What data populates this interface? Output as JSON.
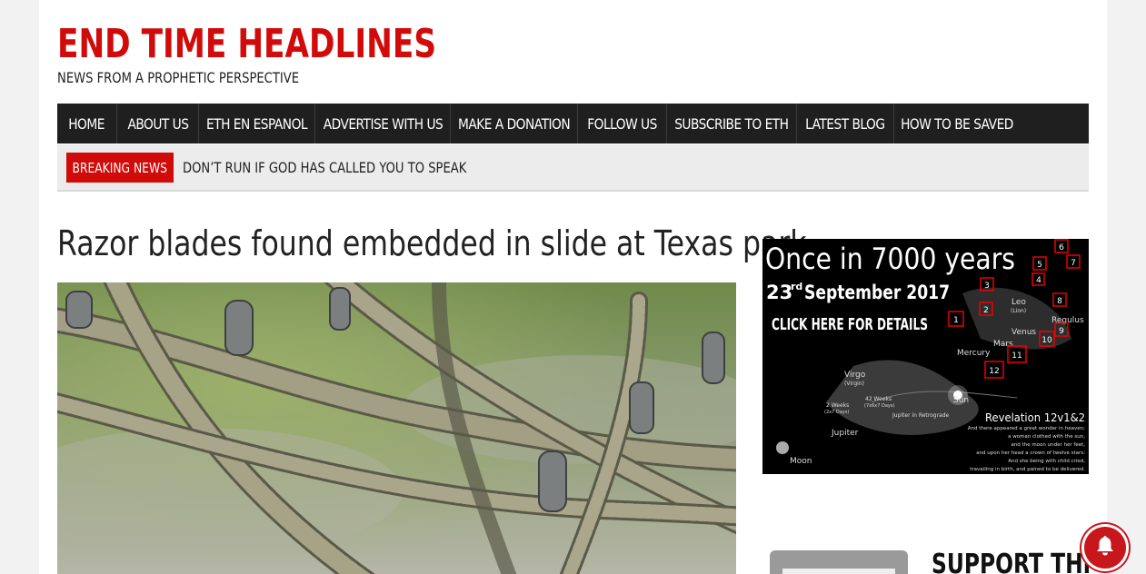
{
  "header": {
    "title": "END TIME HEADLINES",
    "tagline": "NEWS FROM A PROPHETIC PERSPECTIVE"
  },
  "nav": {
    "items": [
      {
        "label": "HOME"
      },
      {
        "label": "ABOUT US"
      },
      {
        "label": "ETH EN ESPANOL"
      },
      {
        "label": "ADVERTISE WITH US"
      },
      {
        "label": "MAKE A DONATION"
      },
      {
        "label": "FOLLOW US"
      },
      {
        "label": "SUBSCRIBE TO ETH"
      },
      {
        "label": "LATEST BLOG"
      },
      {
        "label": "HOW TO BE SAVED"
      }
    ]
  },
  "breaking": {
    "label": "BREAKING NEWS",
    "headline": "DON’T RUN IF GOD HAS CALLED YOU TO SPEAK"
  },
  "article": {
    "title": "Razor blades found embedded in slide at Texas park"
  },
  "sidebar": {
    "ad": {
      "headline": "Once in 7000 years",
      "date_day": "23",
      "date_suffix": "rd",
      "date_rest": "September 2017",
      "cta": "CLICK HERE FOR DETAILS",
      "labels": {
        "leo": "Leo",
        "leo_sub": "(Lion)",
        "regulus": "Regulus",
        "venus": "Venus",
        "mars": "Mars",
        "mercury": "Mercury",
        "virgo": "Virgo",
        "virgo_sub": "(Virgin)",
        "sun": "Sun",
        "jupiter": "Jupiter",
        "jupiter_retro": "Jupiter in Retrograde",
        "moon": "Moon",
        "two_weeks": "2 Weeks",
        "two_weeks_sub": "(2x7 Days)",
        "forty_two_weeks": "42 Weeks",
        "forty_two_weeks_sub": "(7x6x7 Days)",
        "revelation": "Revelation 12v1&2",
        "verse1": "And there appeared a great wonder in heaven;",
        "verse2": "a woman clothed with the sun,",
        "verse3": "and the moon under her feet,",
        "verse4": "and upon her head a crown of twelve stars:",
        "verse5": "And she being with child cried,",
        "verse6": "travailing in birth, and pained to be delivered."
      },
      "numbers": [
        "1",
        "2",
        "3",
        "4",
        "5",
        "6",
        "7",
        "8",
        "9",
        "10",
        "11",
        "12"
      ]
    },
    "support": {
      "text": "SUPPORT THE"
    }
  },
  "notification": {
    "icon": "bell-icon"
  },
  "colors": {
    "brand_red": "#d10a0a",
    "nav_bg": "#1f1f1f",
    "breaking_bg": "#ececec"
  }
}
